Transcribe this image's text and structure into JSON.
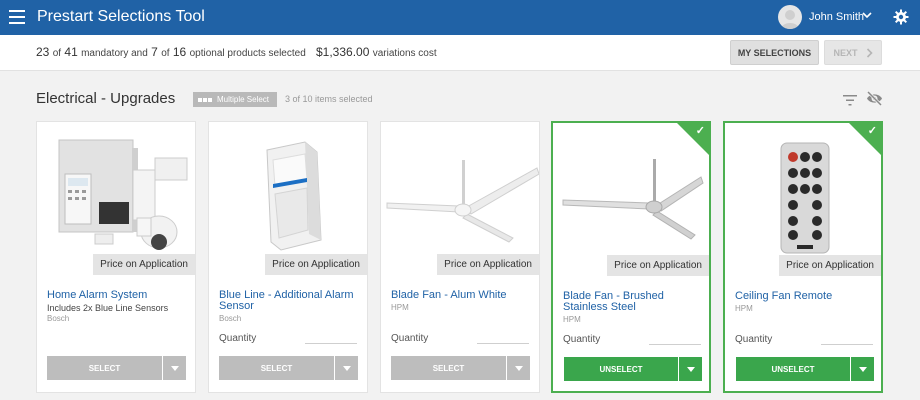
{
  "app": {
    "title": "Prestart Selections Tool",
    "user_name": "John Smith"
  },
  "summary": {
    "mandatory_selected": "23",
    "of1": "of",
    "mandatory_total": "41",
    "mandatory_text": "mandatory and",
    "optional_selected": "7",
    "of2": "of",
    "optional_total": "16",
    "optional_text": "optional products selected",
    "variations_amount": "$1,336.00",
    "variations_text": "variations cost",
    "my_selections_label": "MY SELECTIONS",
    "next_label": "NEXT"
  },
  "section": {
    "title": "Electrical - Upgrades",
    "badge": "Multiple Select",
    "items_selected": "3 of 10 items selected"
  },
  "products": [
    {
      "name": "Home Alarm System",
      "desc": "Includes 2x Blue Line Sensors",
      "brand": "Bosch",
      "price": "Price on Application",
      "qty_label": "",
      "button": "SELECT",
      "selected": false,
      "image": "alarm-system-image"
    },
    {
      "name": "Blue Line - Additional Alarm Sensor",
      "desc": "",
      "brand": "Bosch",
      "price": "Price on Application",
      "qty_label": "Quantity",
      "button": "SELECT",
      "selected": false,
      "image": "alarm-sensor-image"
    },
    {
      "name": "Blade Fan - Alum White",
      "desc": "",
      "brand": "HPM",
      "price": "Price on Application",
      "qty_label": "Quantity",
      "button": "SELECT",
      "selected": false,
      "image": "white-fan-image"
    },
    {
      "name": "Blade Fan - Brushed Stainless Steel",
      "desc": "",
      "brand": "HPM",
      "price": "Price on Application",
      "qty_label": "Quantity",
      "button": "UNSELECT",
      "selected": true,
      "image": "steel-fan-image"
    },
    {
      "name": "Ceiling Fan Remote",
      "desc": "",
      "brand": "HPM",
      "price": "Price on Application",
      "qty_label": "Quantity",
      "button": "UNSELECT",
      "selected": true,
      "image": "remote-image"
    }
  ],
  "colors": {
    "header": "#2062a6",
    "selected": "#4caf50",
    "select_button": "#bdbdbd",
    "unselect_button": "#3aa64c",
    "link": "#2062a6"
  },
  "icons": [
    "hamburger-icon",
    "avatar",
    "chevron-down-icon",
    "gear-icon",
    "filter-icon",
    "eye-off-icon",
    "check-icon",
    "caret-down-icon",
    "chevron-right-icon"
  ]
}
